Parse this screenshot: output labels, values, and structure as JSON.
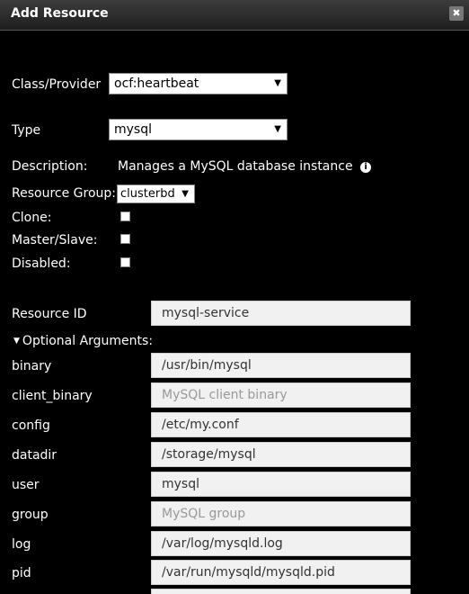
{
  "dialog": {
    "title": "Add Resource",
    "close_glyph": "✖"
  },
  "form": {
    "class_provider_label": "Class/Provider",
    "class_provider_value": "ocf:heartbeat",
    "type_label": "Type",
    "type_value": "mysql",
    "description_label": "Description:",
    "description_value": "Manages a MySQL database instance",
    "info_glyph": "i",
    "resource_group_label": "Resource Group:",
    "resource_group_value": "clusterbd",
    "clone_label": "Clone:",
    "master_slave_label": "Master/Slave:",
    "disabled_label": "Disabled:",
    "resource_id_label": "Resource ID",
    "resource_id_value": "mysql-service",
    "optional_toggle_label": "Optional Arguments:",
    "dropdown_caret": "▼",
    "expanded_caret": "▼"
  },
  "optional_args": [
    {
      "label": "binary",
      "value": "/usr/bin/mysql",
      "placeholder": ""
    },
    {
      "label": "client_binary",
      "value": "",
      "placeholder": "MySQL client binary"
    },
    {
      "label": "config",
      "value": "/etc/my.conf",
      "placeholder": ""
    },
    {
      "label": "datadir",
      "value": "/storage/mysql",
      "placeholder": ""
    },
    {
      "label": "user",
      "value": "mysql",
      "placeholder": ""
    },
    {
      "label": "group",
      "value": "",
      "placeholder": "MySQL group"
    },
    {
      "label": "log",
      "value": "/var/log/mysqld.log",
      "placeholder": ""
    },
    {
      "label": "pid",
      "value": "/var/run/mysqld/mysqld.pid",
      "placeholder": ""
    }
  ]
}
